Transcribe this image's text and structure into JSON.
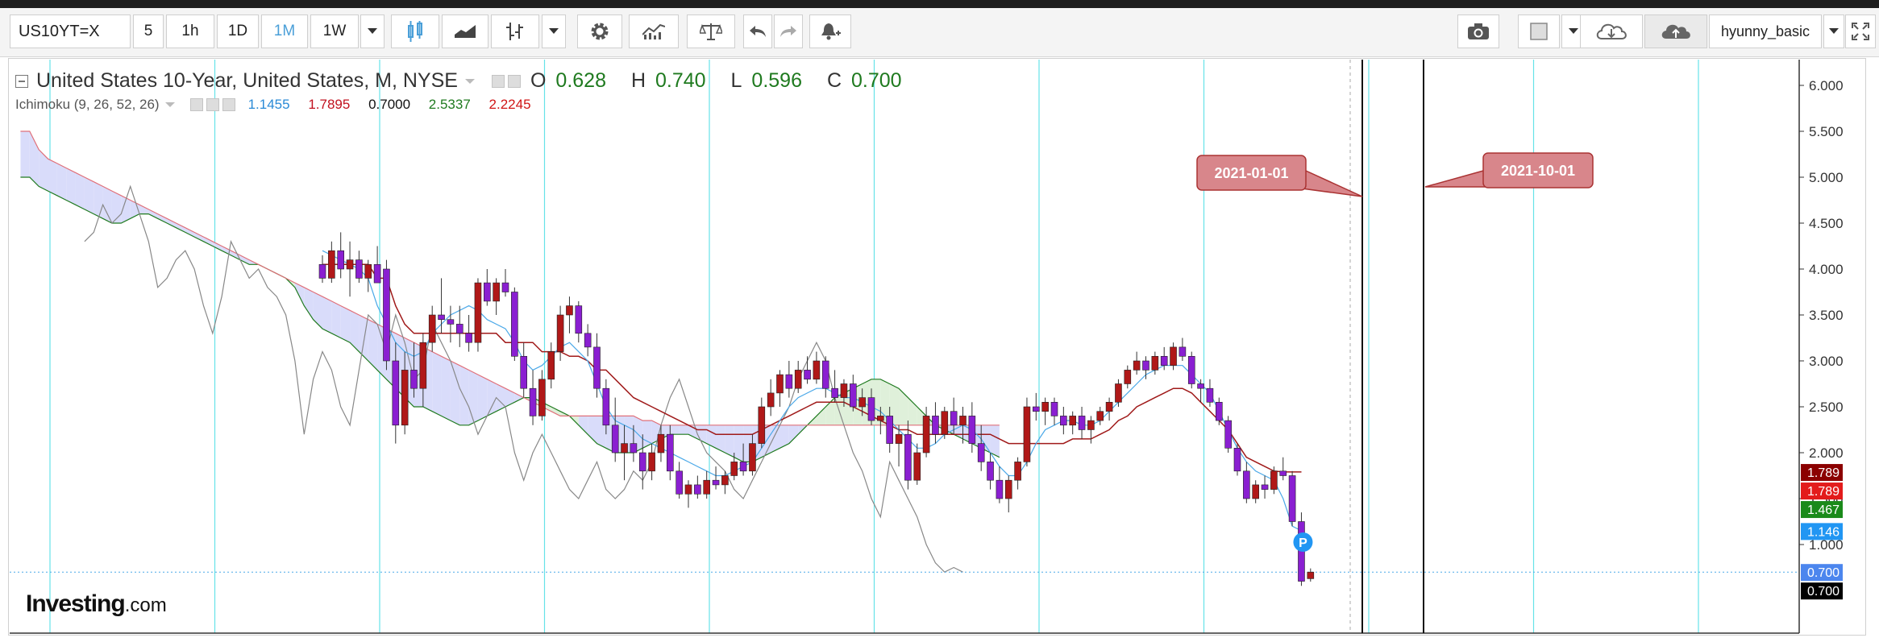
{
  "toolbar": {
    "symbol": "US10YT=X",
    "intervals": [
      "5",
      "1h",
      "1D",
      "1M",
      "1W"
    ],
    "active_interval": "1M",
    "username": "hyunny_basic",
    "icons": [
      "candlestick-icon",
      "area-chart-icon",
      "bar-type-icon",
      "settings-icon",
      "indicators-icon",
      "compare-scale-icon",
      "undo-icon",
      "redo-icon",
      "alert-icon",
      "camera-icon",
      "color-swatch-icon",
      "cloud-download-icon",
      "cloud-upload-icon",
      "fullscreen-icon"
    ]
  },
  "legend": {
    "title": "United States 10-Year, United States, M, NYSE",
    "ohlc": {
      "o_label": "O",
      "o": "0.628",
      "h_label": "H",
      "h": "0.740",
      "l_label": "L",
      "l": "0.596",
      "c_label": "C",
      "c": "0.700"
    },
    "indicator_name": "Ichimoku (9, 26, 52, 26)",
    "indicator_values": [
      "1.1455",
      "1.7895",
      "0.7000",
      "2.5337",
      "2.2245"
    ],
    "indicator_colors": [
      "#2a8ad6",
      "#c1121f",
      "#111111",
      "#1f7a1f",
      "#d01515"
    ]
  },
  "annotations": [
    {
      "label": "2021-01-01"
    },
    {
      "label": "2021-10-01"
    }
  ],
  "marker": {
    "label": "P"
  },
  "logo": {
    "text": "Investing",
    "suffix": ".com"
  },
  "colors": {
    "bull": "#b01818",
    "bear": "#8a1fd1",
    "tenkan": "#4aa8e8",
    "kijun": "#a01a1a",
    "chikou": "#888888",
    "senkou_a": "#1f7a1f",
    "senkou_b": "#e0707a",
    "cloud_bull": "#d9dcfa",
    "cloud_bear": "#dff0da",
    "grid_v": "#66e3e8",
    "price_line": "#4aa8e8"
  },
  "chart_data": {
    "type": "candlestick",
    "ylim": [
      0.6,
      6.2
    ],
    "y_ticks": [
      "6.000",
      "5.500",
      "5.000",
      "4.500",
      "4.000",
      "3.500",
      "3.000",
      "2.500",
      "2.000",
      "1.500",
      "1.000"
    ],
    "price_labels": [
      {
        "text": "1.789",
        "value": 1.789,
        "bg": "#8b0000"
      },
      {
        "text": "1.789",
        "value": 1.789,
        "bg": "#e31b1b"
      },
      {
        "text": "1.467",
        "value": 1.467,
        "bg": "#1a8a1a"
      },
      {
        "text": "1.146",
        "value": 1.146,
        "bg": "#2196f3"
      },
      {
        "text": "0.700",
        "value": 0.7,
        "bg": "#4c86ee"
      },
      {
        "text": "0.700",
        "value": 0.7,
        "bg": "#000000"
      }
    ],
    "candles": [
      {
        "o": 4.05,
        "h": 4.15,
        "l": 3.85,
        "c": 3.9
      },
      {
        "o": 3.9,
        "h": 4.3,
        "l": 3.85,
        "c": 4.2
      },
      {
        "o": 4.2,
        "h": 4.4,
        "l": 3.9,
        "c": 4.0
      },
      {
        "o": 4.0,
        "h": 4.3,
        "l": 3.7,
        "c": 4.1
      },
      {
        "o": 4.1,
        "h": 4.2,
        "l": 3.85,
        "c": 3.9
      },
      {
        "o": 3.9,
        "h": 4.1,
        "l": 3.75,
        "c": 4.05
      },
      {
        "o": 4.05,
        "h": 4.25,
        "l": 3.9,
        "c": 3.85
      },
      {
        "o": 4.0,
        "h": 4.1,
        "l": 2.9,
        "c": 3.0
      },
      {
        "o": 3.0,
        "h": 3.2,
        "l": 2.1,
        "c": 2.3
      },
      {
        "o": 2.3,
        "h": 3.1,
        "l": 2.2,
        "c": 2.9
      },
      {
        "o": 2.9,
        "h": 3.2,
        "l": 2.6,
        "c": 2.7
      },
      {
        "o": 2.7,
        "h": 3.3,
        "l": 2.5,
        "c": 3.2
      },
      {
        "o": 3.2,
        "h": 3.6,
        "l": 3.1,
        "c": 3.5
      },
      {
        "o": 3.5,
        "h": 3.9,
        "l": 3.3,
        "c": 3.45
      },
      {
        "o": 3.45,
        "h": 3.6,
        "l": 3.2,
        "c": 3.4
      },
      {
        "o": 3.4,
        "h": 3.6,
        "l": 3.15,
        "c": 3.3
      },
      {
        "o": 3.3,
        "h": 3.5,
        "l": 3.1,
        "c": 3.2
      },
      {
        "o": 3.2,
        "h": 3.9,
        "l": 3.1,
        "c": 3.85
      },
      {
        "o": 3.85,
        "h": 4.0,
        "l": 3.6,
        "c": 3.65
      },
      {
        "o": 3.65,
        "h": 3.9,
        "l": 3.5,
        "c": 3.85
      },
      {
        "o": 3.85,
        "h": 4.0,
        "l": 3.7,
        "c": 3.75
      },
      {
        "o": 3.75,
        "h": 3.8,
        "l": 3.0,
        "c": 3.05
      },
      {
        "o": 3.05,
        "h": 3.2,
        "l": 2.6,
        "c": 2.7
      },
      {
        "o": 2.7,
        "h": 2.9,
        "l": 2.3,
        "c": 2.4
      },
      {
        "o": 2.4,
        "h": 2.9,
        "l": 2.35,
        "c": 2.8
      },
      {
        "o": 2.8,
        "h": 3.2,
        "l": 2.7,
        "c": 3.1
      },
      {
        "o": 3.1,
        "h": 3.6,
        "l": 3.0,
        "c": 3.5
      },
      {
        "o": 3.5,
        "h": 3.7,
        "l": 3.3,
        "c": 3.6
      },
      {
        "o": 3.6,
        "h": 3.65,
        "l": 3.2,
        "c": 3.3
      },
      {
        "o": 3.3,
        "h": 3.4,
        "l": 3.05,
        "c": 3.15
      },
      {
        "o": 3.15,
        "h": 3.3,
        "l": 2.6,
        "c": 2.7
      },
      {
        "o": 2.7,
        "h": 2.8,
        "l": 2.2,
        "c": 2.3
      },
      {
        "o": 2.3,
        "h": 2.6,
        "l": 1.9,
        "c": 2.0
      },
      {
        "o": 2.0,
        "h": 2.3,
        "l": 1.7,
        "c": 2.1
      },
      {
        "o": 2.1,
        "h": 2.3,
        "l": 1.9,
        "c": 2.0
      },
      {
        "o": 2.0,
        "h": 2.2,
        "l": 1.6,
        "c": 1.8
      },
      {
        "o": 1.8,
        "h": 2.1,
        "l": 1.7,
        "c": 2.0
      },
      {
        "o": 2.0,
        "h": 2.3,
        "l": 1.9,
        "c": 2.2
      },
      {
        "o": 2.2,
        "h": 2.3,
        "l": 1.7,
        "c": 1.8
      },
      {
        "o": 1.8,
        "h": 1.9,
        "l": 1.5,
        "c": 1.55
      },
      {
        "o": 1.55,
        "h": 1.7,
        "l": 1.4,
        "c": 1.65
      },
      {
        "o": 1.65,
        "h": 1.75,
        "l": 1.5,
        "c": 1.55
      },
      {
        "o": 1.55,
        "h": 1.8,
        "l": 1.5,
        "c": 1.7
      },
      {
        "o": 1.7,
        "h": 1.85,
        "l": 1.6,
        "c": 1.65
      },
      {
        "o": 1.65,
        "h": 1.8,
        "l": 1.55,
        "c": 1.75
      },
      {
        "o": 1.75,
        "h": 2.0,
        "l": 1.7,
        "c": 1.9
      },
      {
        "o": 1.9,
        "h": 2.1,
        "l": 1.75,
        "c": 1.8
      },
      {
        "o": 1.8,
        "h": 2.2,
        "l": 1.75,
        "c": 2.1
      },
      {
        "o": 2.1,
        "h": 2.6,
        "l": 2.05,
        "c": 2.5
      },
      {
        "o": 2.5,
        "h": 2.8,
        "l": 2.4,
        "c": 2.65
      },
      {
        "o": 2.65,
        "h": 2.9,
        "l": 2.5,
        "c": 2.85
      },
      {
        "o": 2.85,
        "h": 3.0,
        "l": 2.6,
        "c": 2.7
      },
      {
        "o": 2.7,
        "h": 3.0,
        "l": 2.65,
        "c": 2.9
      },
      {
        "o": 2.9,
        "h": 3.05,
        "l": 2.75,
        "c": 2.8
      },
      {
        "o": 2.8,
        "h": 3.1,
        "l": 2.75,
        "c": 3.0
      },
      {
        "o": 3.0,
        "h": 3.05,
        "l": 2.6,
        "c": 2.7
      },
      {
        "o": 2.7,
        "h": 2.9,
        "l": 2.55,
        "c": 2.6
      },
      {
        "o": 2.6,
        "h": 2.8,
        "l": 2.5,
        "c": 2.75
      },
      {
        "o": 2.75,
        "h": 2.85,
        "l": 2.45,
        "c": 2.5
      },
      {
        "o": 2.5,
        "h": 2.7,
        "l": 2.4,
        "c": 2.6
      },
      {
        "o": 2.6,
        "h": 2.7,
        "l": 2.3,
        "c": 2.35
      },
      {
        "o": 2.35,
        "h": 2.5,
        "l": 2.2,
        "c": 2.4
      },
      {
        "o": 2.4,
        "h": 2.5,
        "l": 2.0,
        "c": 2.1
      },
      {
        "o": 2.1,
        "h": 2.3,
        "l": 1.85,
        "c": 2.2
      },
      {
        "o": 2.2,
        "h": 2.35,
        "l": 1.6,
        "c": 1.7
      },
      {
        "o": 1.7,
        "h": 2.1,
        "l": 1.65,
        "c": 2.0
      },
      {
        "o": 2.0,
        "h": 2.5,
        "l": 1.95,
        "c": 2.4
      },
      {
        "o": 2.4,
        "h": 2.55,
        "l": 2.1,
        "c": 2.2
      },
      {
        "o": 2.2,
        "h": 2.5,
        "l": 2.15,
        "c": 2.45
      },
      {
        "o": 2.45,
        "h": 2.6,
        "l": 2.2,
        "c": 2.3
      },
      {
        "o": 2.3,
        "h": 2.5,
        "l": 2.1,
        "c": 2.4
      },
      {
        "o": 2.4,
        "h": 2.55,
        "l": 2.0,
        "c": 2.1
      },
      {
        "o": 2.1,
        "h": 2.3,
        "l": 1.8,
        "c": 1.9
      },
      {
        "o": 1.9,
        "h": 2.0,
        "l": 1.6,
        "c": 1.7
      },
      {
        "o": 1.7,
        "h": 1.85,
        "l": 1.45,
        "c": 1.5
      },
      {
        "o": 1.5,
        "h": 1.75,
        "l": 1.35,
        "c": 1.7
      },
      {
        "o": 1.7,
        "h": 1.95,
        "l": 1.6,
        "c": 1.9
      },
      {
        "o": 1.9,
        "h": 2.6,
        "l": 1.85,
        "c": 2.5
      },
      {
        "o": 2.5,
        "h": 2.65,
        "l": 2.35,
        "c": 2.45
      },
      {
        "o": 2.45,
        "h": 2.6,
        "l": 2.3,
        "c": 2.55
      },
      {
        "o": 2.55,
        "h": 2.6,
        "l": 2.3,
        "c": 2.4
      },
      {
        "o": 2.4,
        "h": 2.5,
        "l": 2.2,
        "c": 2.3
      },
      {
        "o": 2.3,
        "h": 2.45,
        "l": 2.2,
        "c": 2.4
      },
      {
        "o": 2.4,
        "h": 2.5,
        "l": 2.15,
        "c": 2.25
      },
      {
        "o": 2.25,
        "h": 2.4,
        "l": 2.1,
        "c": 2.35
      },
      {
        "o": 2.35,
        "h": 2.5,
        "l": 2.3,
        "c": 2.45
      },
      {
        "o": 2.45,
        "h": 2.6,
        "l": 2.35,
        "c": 2.55
      },
      {
        "o": 2.55,
        "h": 2.8,
        "l": 2.5,
        "c": 2.75
      },
      {
        "o": 2.75,
        "h": 2.95,
        "l": 2.7,
        "c": 2.9
      },
      {
        "o": 2.9,
        "h": 3.1,
        "l": 2.85,
        "c": 3.0
      },
      {
        "o": 3.0,
        "h": 3.05,
        "l": 2.8,
        "c": 2.9
      },
      {
        "o": 2.9,
        "h": 3.1,
        "l": 2.85,
        "c": 3.05
      },
      {
        "o": 3.05,
        "h": 3.15,
        "l": 2.9,
        "c": 2.95
      },
      {
        "o": 2.95,
        "h": 3.2,
        "l": 2.9,
        "c": 3.15
      },
      {
        "o": 3.15,
        "h": 3.25,
        "l": 3.0,
        "c": 3.05
      },
      {
        "o": 3.05,
        "h": 3.1,
        "l": 2.7,
        "c": 2.75
      },
      {
        "o": 2.75,
        "h": 2.8,
        "l": 2.55,
        "c": 2.7
      },
      {
        "o": 2.7,
        "h": 2.8,
        "l": 2.5,
        "c": 2.55
      },
      {
        "o": 2.55,
        "h": 2.6,
        "l": 2.3,
        "c": 2.35
      },
      {
        "o": 2.35,
        "h": 2.4,
        "l": 2.0,
        "c": 2.05
      },
      {
        "o": 2.05,
        "h": 2.1,
        "l": 1.75,
        "c": 1.8
      },
      {
        "o": 1.8,
        "h": 1.9,
        "l": 1.45,
        "c": 1.5
      },
      {
        "o": 1.5,
        "h": 1.7,
        "l": 1.45,
        "c": 1.65
      },
      {
        "o": 1.65,
        "h": 1.75,
        "l": 1.5,
        "c": 1.6
      },
      {
        "o": 1.6,
        "h": 1.85,
        "l": 1.55,
        "c": 1.8
      },
      {
        "o": 1.8,
        "h": 1.95,
        "l": 1.7,
        "c": 1.75
      },
      {
        "o": 1.75,
        "h": 1.8,
        "l": 1.2,
        "c": 1.25
      },
      {
        "o": 1.25,
        "h": 1.35,
        "l": 0.55,
        "c": 0.6
      },
      {
        "o": 0.628,
        "h": 0.74,
        "l": 0.596,
        "c": 0.7
      }
    ],
    "tenkan": [
      4.2,
      4.15,
      4.1,
      4.05,
      4.0,
      3.9,
      3.6,
      3.4,
      3.2,
      3.1,
      3.05,
      3.1,
      3.3,
      3.4,
      3.5,
      3.55,
      3.6,
      3.55,
      3.45,
      3.4,
      3.35,
      3.2,
      3.0,
      2.9,
      2.95,
      3.05,
      3.15,
      3.2,
      3.1,
      3.0,
      2.75,
      2.5,
      2.35,
      2.3,
      2.25,
      2.15,
      2.1,
      2.05,
      2.0,
      1.95,
      1.9,
      1.85,
      1.8,
      1.75,
      1.75,
      1.8,
      1.85,
      1.9,
      2.05,
      2.2,
      2.35,
      2.5,
      2.6,
      2.65,
      2.7,
      2.7,
      2.65,
      2.6,
      2.6,
      2.55,
      2.5,
      2.45,
      2.35,
      2.25,
      2.15,
      2.05,
      2.05,
      2.1,
      2.2,
      2.25,
      2.3,
      2.25,
      2.15,
      2.0,
      1.85,
      1.75,
      1.75,
      1.9,
      2.1,
      2.25,
      2.3,
      2.35,
      2.35,
      2.3,
      2.3,
      2.35,
      2.45,
      2.55,
      2.65,
      2.75,
      2.85,
      2.9,
      2.95,
      2.95,
      2.95,
      2.85,
      2.75,
      2.65,
      2.45,
      2.25,
      2.05,
      1.9,
      1.8,
      1.75,
      1.7,
      1.5,
      1.2,
      1.15
    ],
    "kijun": [
      4.05,
      4.05,
      4.05,
      4.05,
      4.05,
      4.05,
      3.9,
      3.9,
      3.6,
      3.4,
      3.3,
      3.3,
      3.3,
      3.3,
      3.3,
      3.3,
      3.3,
      3.3,
      3.3,
      3.3,
      3.2,
      3.2,
      3.2,
      3.2,
      3.1,
      3.1,
      3.1,
      3.05,
      3.05,
      3.0,
      2.9,
      2.9,
      2.8,
      2.7,
      2.6,
      2.55,
      2.5,
      2.45,
      2.4,
      2.35,
      2.3,
      2.25,
      2.25,
      2.2,
      2.2,
      2.2,
      2.2,
      2.2,
      2.25,
      2.3,
      2.35,
      2.4,
      2.45,
      2.5,
      2.55,
      2.55,
      2.55,
      2.55,
      2.5,
      2.45,
      2.4,
      2.35,
      2.3,
      2.25,
      2.25,
      2.2,
      2.2,
      2.2,
      2.2,
      2.2,
      2.2,
      2.2,
      2.2,
      2.2,
      2.15,
      2.1,
      2.1,
      2.1,
      2.1,
      2.1,
      2.1,
      2.1,
      2.15,
      2.15,
      2.15,
      2.2,
      2.25,
      2.35,
      2.4,
      2.5,
      2.55,
      2.6,
      2.65,
      2.7,
      2.7,
      2.65,
      2.55,
      2.45,
      2.35,
      2.25,
      2.1,
      1.95,
      1.9,
      1.85,
      1.8,
      1.79,
      1.79,
      1.79
    ],
    "chikou": [
      4.3,
      4.4,
      4.7,
      4.5,
      4.6,
      4.9,
      4.6,
      4.3,
      3.8,
      3.9,
      4.1,
      4.2,
      4.0,
      3.6,
      3.3,
      3.7,
      4.3,
      4.1,
      3.9,
      4.0,
      3.8,
      3.7,
      3.5,
      3.0,
      2.2,
      2.8,
      3.1,
      2.9,
      2.5,
      2.3,
      2.9,
      3.5,
      3.4,
      3.1,
      3.5,
      3.2,
      2.8,
      2.9,
      3.4,
      3.2,
      3.0,
      2.7,
      2.5,
      2.2,
      2.4,
      2.6,
      2.5,
      2.0,
      1.7,
      2.0,
      2.2,
      2.0,
      1.8,
      1.6,
      1.5,
      1.7,
      1.9,
      1.6,
      1.5,
      1.6,
      1.8,
      1.7,
      1.9,
      2.3,
      2.6,
      2.8,
      2.5,
      2.2,
      2.0,
      1.9,
      1.8,
      1.6,
      1.5,
      1.7,
      1.9,
      2.1,
      2.3,
      2.5,
      2.8,
      3.0,
      3.2,
      3.0,
      2.6,
      2.3,
      2.0,
      1.8,
      1.5,
      1.3,
      1.9,
      1.7,
      1.5,
      1.3,
      1.0,
      0.8,
      0.7,
      0.75,
      0.7
    ],
    "span_a": [
      5.0,
      5.0,
      4.9,
      4.85,
      4.8,
      4.75,
      4.7,
      4.65,
      4.6,
      4.55,
      4.5,
      4.5,
      4.55,
      4.6,
      4.6,
      4.55,
      4.5,
      4.45,
      4.4,
      4.35,
      4.3,
      4.25,
      4.2,
      4.15,
      4.1,
      4.05,
      4.05,
      4.0,
      3.95,
      3.9,
      3.8,
      3.6,
      3.45,
      3.35,
      3.3,
      3.25,
      3.2,
      3.1,
      3.0,
      2.9,
      2.8,
      2.7,
      2.6,
      2.5,
      2.5,
      2.45,
      2.4,
      2.35,
      2.3,
      2.3,
      2.35,
      2.4,
      2.45,
      2.5,
      2.55,
      2.6,
      2.6,
      2.55,
      2.5,
      2.45,
      2.4,
      2.3,
      2.2,
      2.1,
      2.05,
      2.0,
      2.0,
      2.0,
      2.05,
      2.1,
      2.15,
      2.2,
      2.2,
      2.2,
      2.15,
      2.1,
      2.05,
      2.0,
      1.95,
      1.9,
      1.9,
      1.95,
      2.0,
      2.05,
      2.1,
      2.2,
      2.3,
      2.4,
      2.5,
      2.6,
      2.65,
      2.7,
      2.75,
      2.8,
      2.8,
      2.75,
      2.7,
      2.6,
      2.5,
      2.4,
      2.3,
      2.25,
      2.2,
      2.15,
      2.1,
      2.05,
      2.0,
      1.95
    ],
    "span_b": [
      5.5,
      5.5,
      5.3,
      5.2,
      5.15,
      5.1,
      5.05,
      5.0,
      4.95,
      4.9,
      4.85,
      4.8,
      4.75,
      4.7,
      4.65,
      4.6,
      4.55,
      4.5,
      4.45,
      4.4,
      4.35,
      4.3,
      4.25,
      4.2,
      4.15,
      4.1,
      4.05,
      4.0,
      3.95,
      3.9,
      3.85,
      3.8,
      3.75,
      3.7,
      3.65,
      3.6,
      3.55,
      3.5,
      3.45,
      3.4,
      3.35,
      3.3,
      3.25,
      3.2,
      3.15,
      3.1,
      3.05,
      3.0,
      2.95,
      2.9,
      2.85,
      2.8,
      2.75,
      2.7,
      2.65,
      2.6,
      2.55,
      2.5,
      2.45,
      2.4,
      2.4,
      2.4,
      2.4,
      2.4,
      2.4,
      2.4,
      2.4,
      2.4,
      2.35,
      2.35,
      2.3,
      2.3,
      2.3,
      2.3,
      2.3,
      2.3,
      2.3,
      2.3,
      2.3,
      2.3,
      2.3,
      2.3,
      2.3,
      2.3,
      2.3,
      2.3,
      2.3,
      2.3,
      2.3,
      2.3,
      2.3,
      2.3,
      2.3,
      2.3,
      2.3,
      2.3,
      2.3,
      2.3,
      2.3,
      2.3,
      2.3,
      2.3,
      2.3,
      2.3,
      2.3,
      2.3,
      2.3,
      2.3
    ]
  }
}
